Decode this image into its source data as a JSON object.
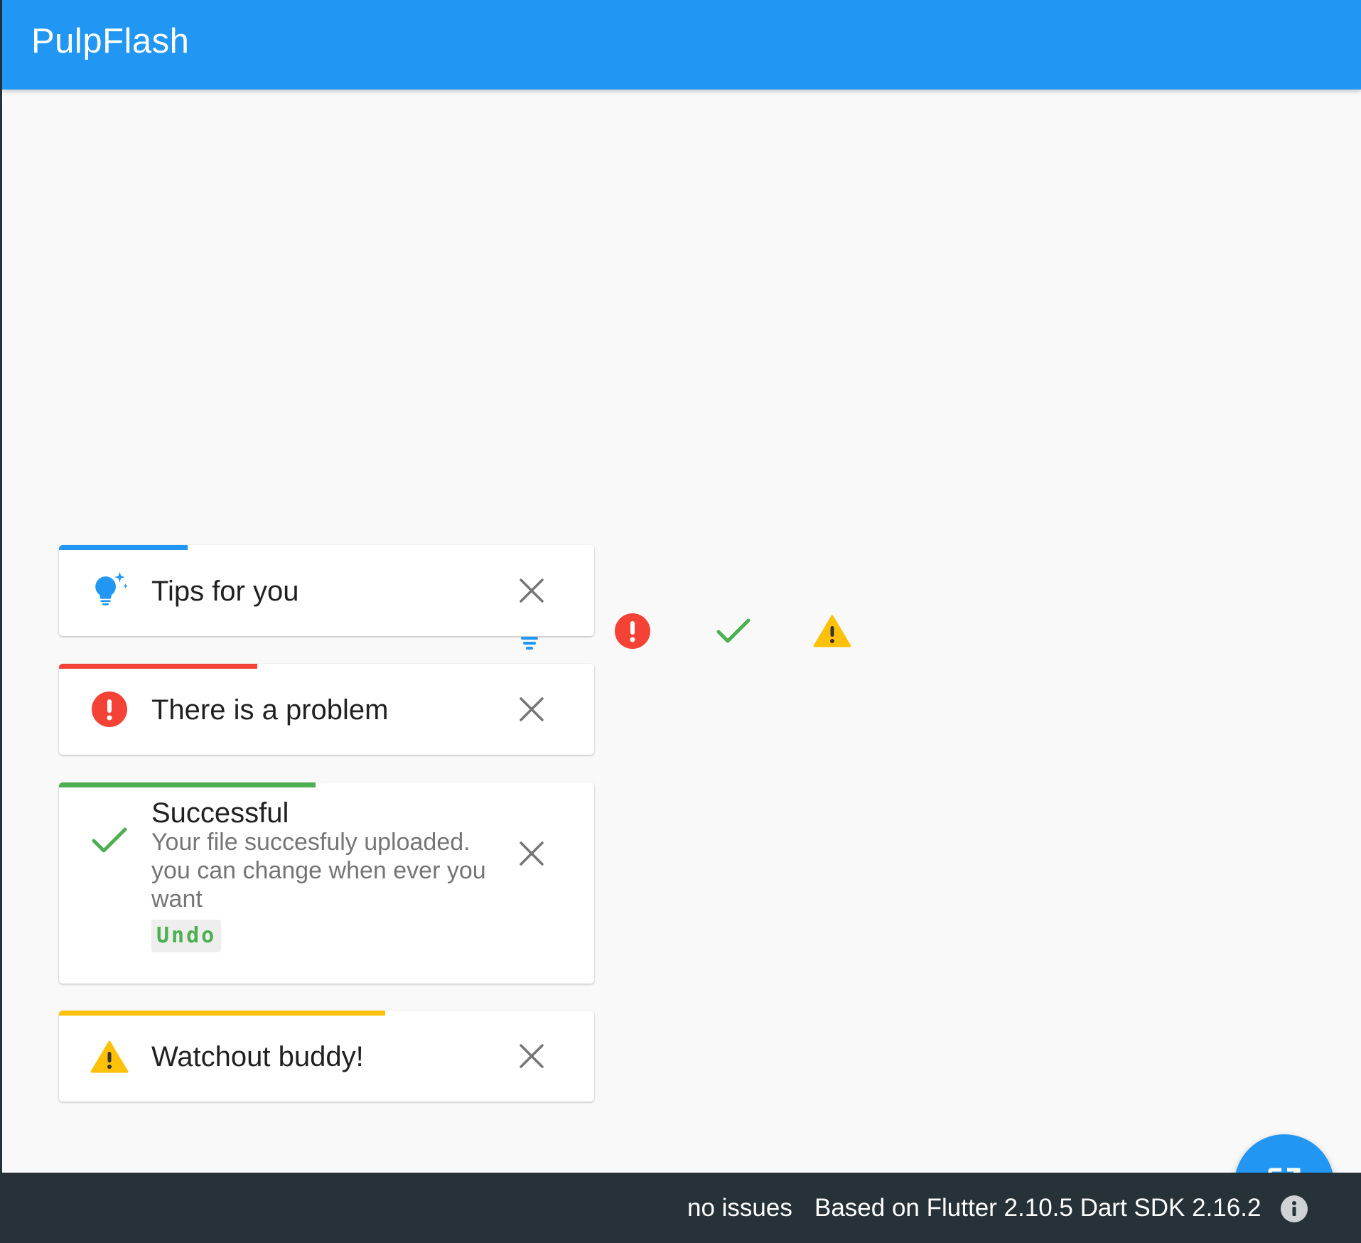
{
  "app": {
    "title": "PulpFlash"
  },
  "colors": {
    "primary": "#2196f3",
    "error": "#f44336",
    "success": "#4caf50",
    "warning": "#ffc107",
    "statusbar": "#263238"
  },
  "flashes": [
    {
      "type": "info",
      "icon": "lightbulb-sparkle-icon",
      "title": "Tips for you",
      "progress": 0.24,
      "close_icon": "close-icon"
    },
    {
      "type": "error",
      "icon": "error-circle-icon",
      "title": "There is a problem",
      "progress": 0.37,
      "close_icon": "close-icon"
    },
    {
      "type": "success",
      "icon": "check-icon",
      "title": "Successful",
      "description": "Your file succesfuly uploaded. you can change when ever you want",
      "action_label": "Undo",
      "progress": 0.48,
      "close_icon": "close-icon"
    },
    {
      "type": "warning",
      "icon": "warning-triangle-icon",
      "title": "Watchout buddy!",
      "progress": 0.61,
      "close_icon": "close-icon"
    }
  ],
  "status_icons": [
    "error-circle-icon",
    "check-icon",
    "warning-triangle-icon"
  ],
  "fab": {
    "icon": "open-in-new-icon"
  },
  "statusbar": {
    "issues": "no issues",
    "version": "Based on Flutter 2.10.5 Dart SDK 2.16.2",
    "info_icon": "info-icon"
  }
}
